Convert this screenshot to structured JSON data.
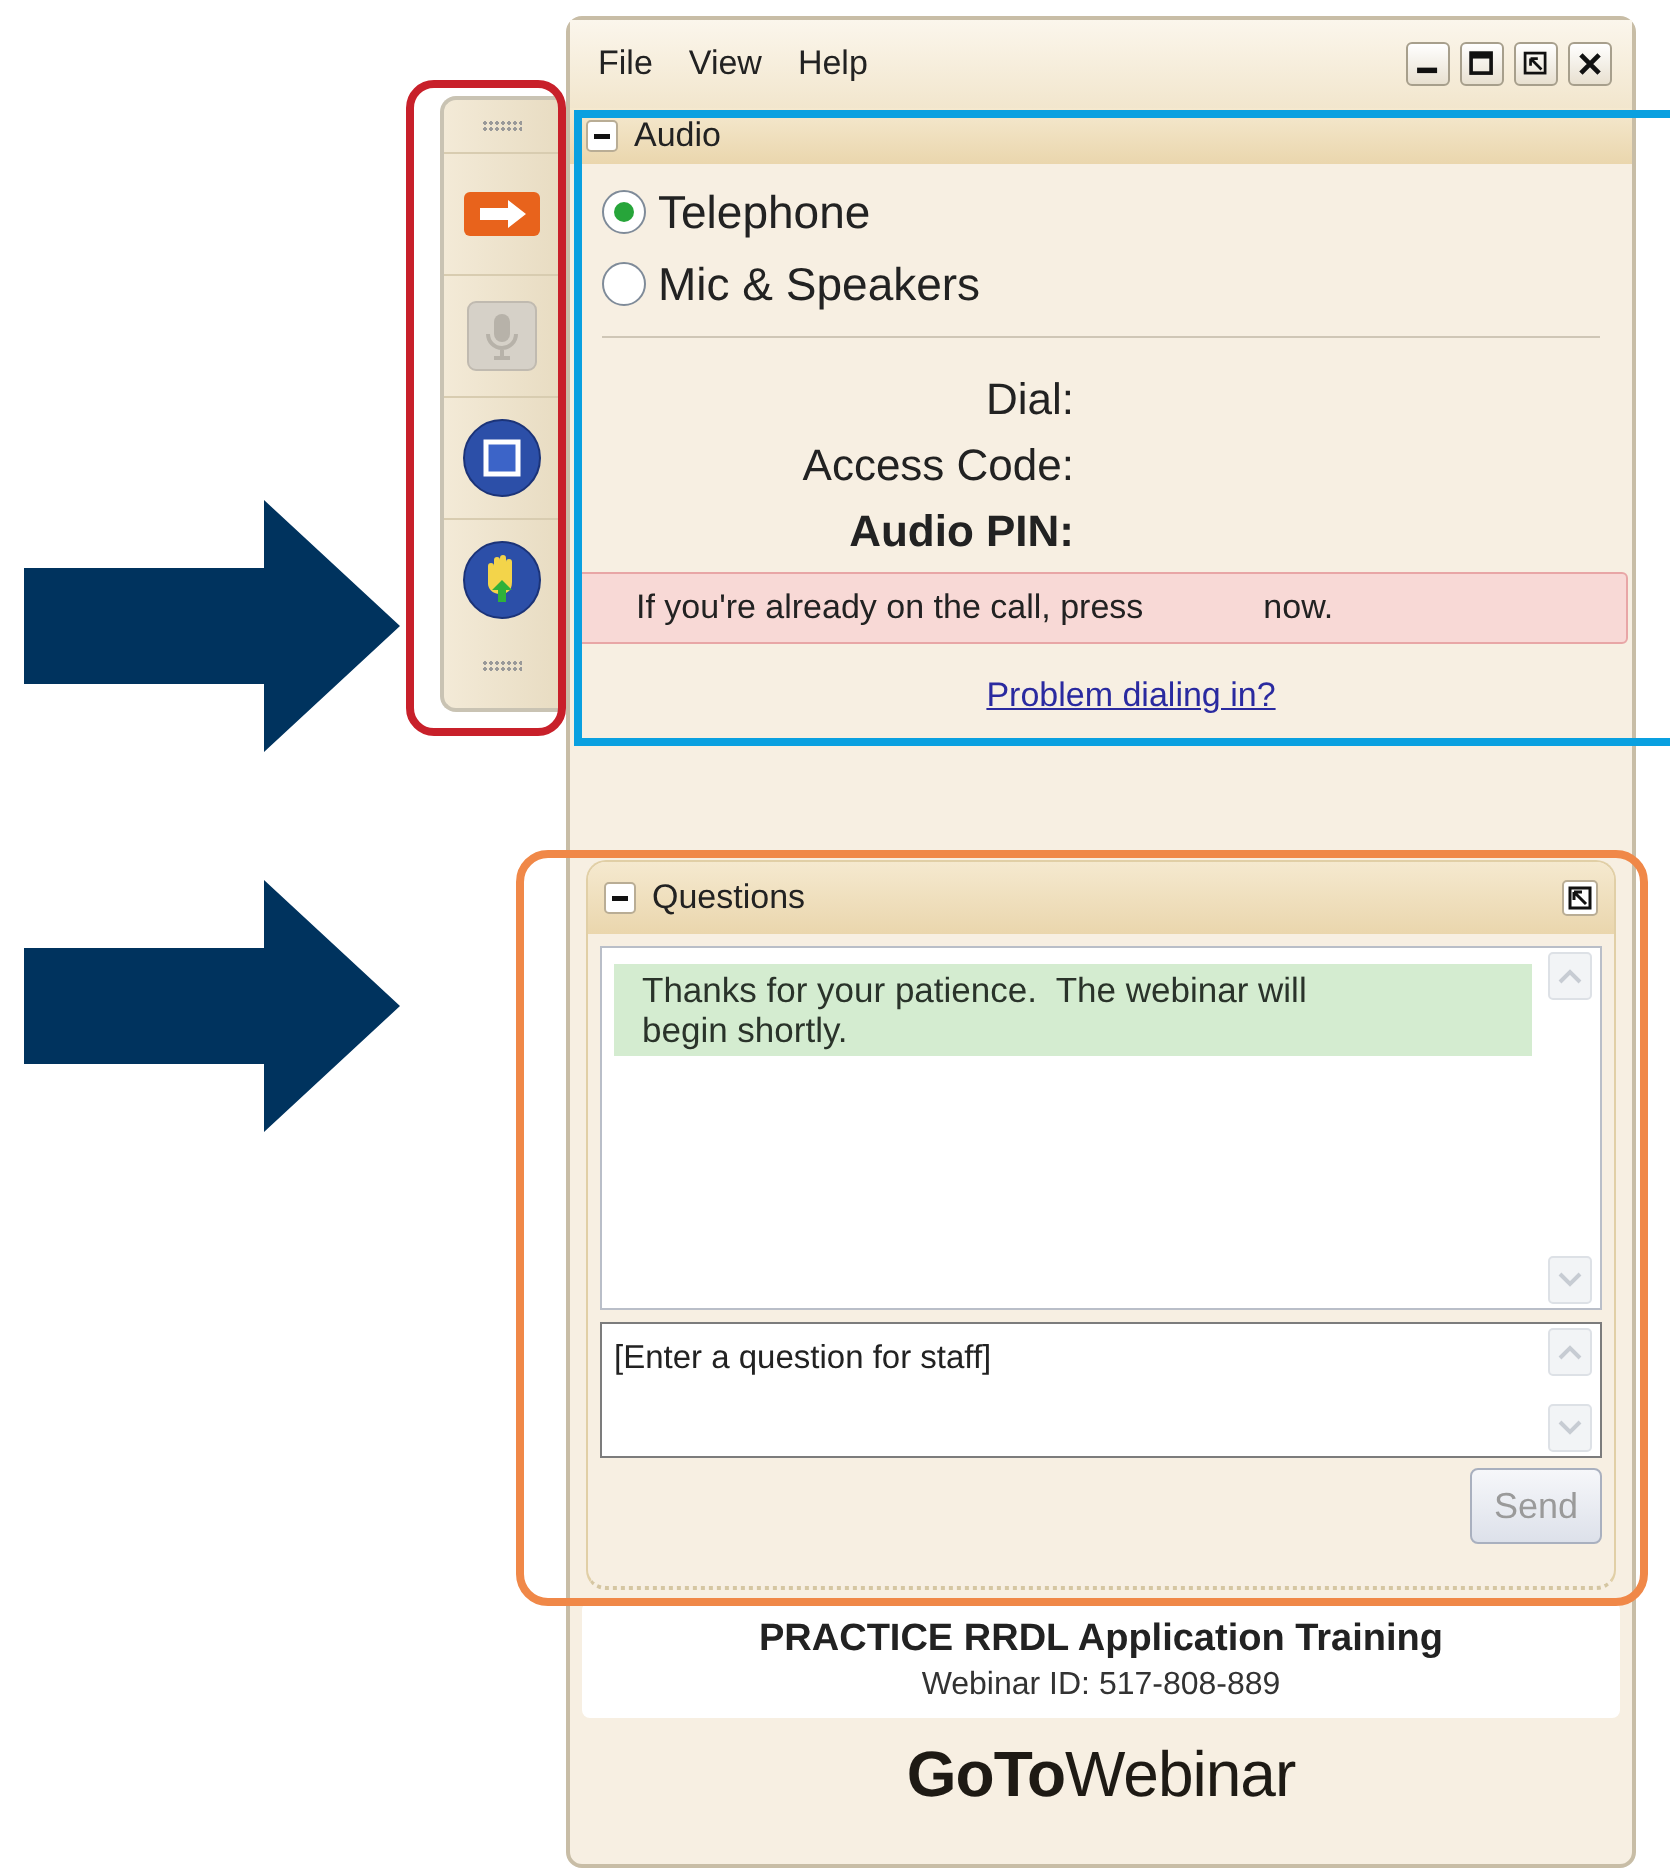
{
  "menu": [
    "File",
    "View",
    "Help"
  ],
  "toolbar": [
    {
      "kind": "arrow",
      "disabled": false
    },
    {
      "kind": "mic",
      "disabled": true
    },
    {
      "kind": "screen",
      "disabled": false
    },
    {
      "kind": "hand",
      "disabled": false
    }
  ],
  "audio": {
    "title": "Audio",
    "options": [
      {
        "label": "Telephone",
        "selected": true
      },
      {
        "label": "Mic & Speakers",
        "selected": false
      }
    ],
    "fields": [
      {
        "label": "Dial:",
        "kind": "normal"
      },
      {
        "label": "Access Code:",
        "kind": "normal"
      },
      {
        "label": "Audio PIN:",
        "kind": "bold"
      }
    ],
    "notice": [
      "If you're already on the call, press",
      "now."
    ],
    "link": "Problem dialing in?"
  },
  "questions": {
    "title": "Questions",
    "messages": [
      "Thanks for your patience.  The webinar will begin shortly."
    ],
    "placeholder": "[Enter a question for staff]",
    "send": {
      "label": "Send",
      "disabled": true
    }
  },
  "footer": {
    "title": "PRACTICE RRDL Application Training",
    "webinar_id": "Webinar ID: 517-808-889",
    "logo": "**GoTo**Webinar"
  },
  "annotations": [
    {
      "kind": "box",
      "color": "#c8202a"
    },
    {
      "kind": "box",
      "color": "#0aa0e0"
    },
    {
      "kind": "box",
      "color": "#f08848"
    },
    {
      "kind": "arrow",
      "color": "#00335e"
    },
    {
      "kind": "arrow",
      "color": "#00335e"
    }
  ]
}
